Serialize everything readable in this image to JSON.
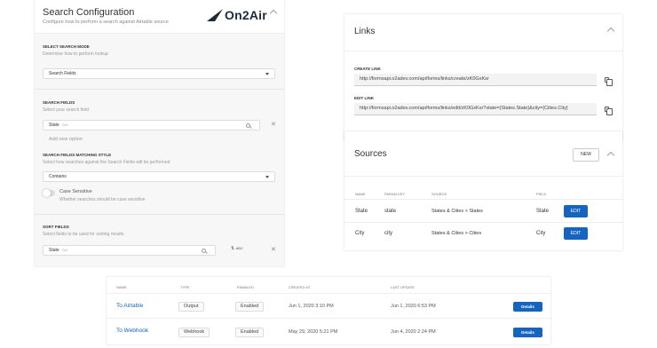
{
  "search_config": {
    "title": "Search Configuration",
    "subtitle": "Configure how to perform a search against Airtable source",
    "logo_text": "On2Air",
    "mode": {
      "label": "SELECT SEARCH MODE",
      "help": "Determine how to perform lookup",
      "value": "Search Fields"
    },
    "fields": {
      "label": "SEARCH FIELDS",
      "help": "Select your search field",
      "value": "State",
      "value_tag": "Text",
      "add_option": "Add new option"
    },
    "matching": {
      "label": "SEARCH FIELDS MATCHING STYLE",
      "help": "Select how searches against the Search Fields will be performed",
      "value": "Contains"
    },
    "case_sensitive": {
      "label": "Case Sensitive",
      "help": "Whether searches should be case sensitive",
      "enabled": false
    },
    "sort": {
      "label": "SORT FIELDS",
      "help": "Select fields to be used for sorting results",
      "value": "State",
      "value_tag": "Text",
      "order": "ABC"
    }
  },
  "links": {
    "title": "Links",
    "create_label": "CREATE LINK",
    "create_url": "http://formsapi.o2adev.com/api/forms/links/create/zK0GxKsr",
    "edit_label": "EDIT LINK",
    "edit_url": "http://formsapi.o2adev.com/api/forms/links/edit/zK0GxKsr?state={States.State}&city={Cities.City}"
  },
  "sources": {
    "title": "Sources",
    "new_label": "NEW",
    "columns": [
      "NAME",
      "PARAM KEY",
      "SOURCE",
      "FIELD"
    ],
    "edit_label": "EDIT",
    "rows": [
      {
        "name": "State",
        "param": "state",
        "source": "States & Cities > States",
        "field": "State"
      },
      {
        "name": "City",
        "param": "city",
        "source": "States & Cities > Cities",
        "field": "City"
      }
    ]
  },
  "destinations": {
    "columns": [
      "NAME",
      "TYPE",
      "ENABLED",
      "CREATED AT",
      "LAST UPDATE"
    ],
    "details_label": "Details",
    "rows": [
      {
        "name": "To Airtable",
        "type": "Output",
        "enabled": "Enabled",
        "created": "Jun 1, 2020 3:10 PM",
        "updated": "Jun 1, 2020 6:53 PM"
      },
      {
        "name": "To Webhook",
        "type": "Webhook",
        "enabled": "Enabled",
        "created": "May 29, 2020 5:21 PM",
        "updated": "Jun 4, 2020 2:24 PM"
      }
    ]
  },
  "colors": {
    "accent": "#1565c0",
    "brand_dark": "#1e2a38"
  }
}
